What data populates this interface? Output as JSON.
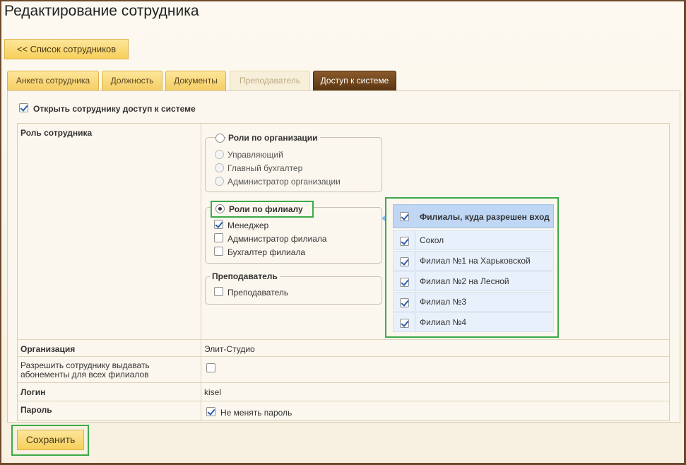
{
  "page": {
    "title": "Редактирование сотрудника",
    "back_button": "<< Список сотрудников"
  },
  "tabs": [
    {
      "label": "Анкета сотрудника",
      "state": "normal"
    },
    {
      "label": "Должность",
      "state": "normal"
    },
    {
      "label": "Документы",
      "state": "normal"
    },
    {
      "label": "Преподаватель",
      "state": "disabled"
    },
    {
      "label": "Доступ к системе",
      "state": "active"
    }
  ],
  "access": {
    "open_access_label": "Открыть сотруднику доступ к системе",
    "open_access_checked": true
  },
  "role": {
    "row_label": "Роль сотрудника",
    "org_roles": {
      "title": "Роли по организации",
      "selected": false,
      "items": [
        "Управляющий",
        "Главный бухгалтер",
        "Администратор организации"
      ]
    },
    "branch_roles": {
      "title": "Роли по филиалу",
      "selected": true,
      "items": [
        {
          "label": "Менеджер",
          "checked": true
        },
        {
          "label": "Администратор филиала",
          "checked": false
        },
        {
          "label": "Бухгалтер филиала",
          "checked": false
        }
      ]
    },
    "teacher": {
      "title": "Преподаватель",
      "items": [
        {
          "label": "Преподаватель",
          "checked": false
        }
      ]
    }
  },
  "branches": {
    "header": "Филиалы, куда разрешен вход",
    "header_checked": true,
    "items": [
      {
        "label": "Сокол",
        "checked": true
      },
      {
        "label": "Филиал №1 на Харьковской",
        "checked": true
      },
      {
        "label": "Филиал №2 на Лесной",
        "checked": true
      },
      {
        "label": "Филиал №3",
        "checked": true
      },
      {
        "label": "Филиал №4",
        "checked": true
      }
    ]
  },
  "fields": {
    "organization_label": "Организация",
    "organization_value": "Элит-Студио",
    "subscriptions_label": "Разрешить сотруднику выдавать абонементы для всех филиалов",
    "subscriptions_checked": false,
    "login_label": "Логин",
    "login_value": "kisel",
    "password_label": "Пароль",
    "password_keep_label": "Не менять пароль",
    "password_keep_checked": true
  },
  "save_button": "Сохранить",
  "colors": {
    "accent_active_tab": "#5a3512",
    "button_yellow": "#f7cf5a",
    "highlight_green": "#3caa4a",
    "branch_header_blue": "#bfd6f4"
  }
}
